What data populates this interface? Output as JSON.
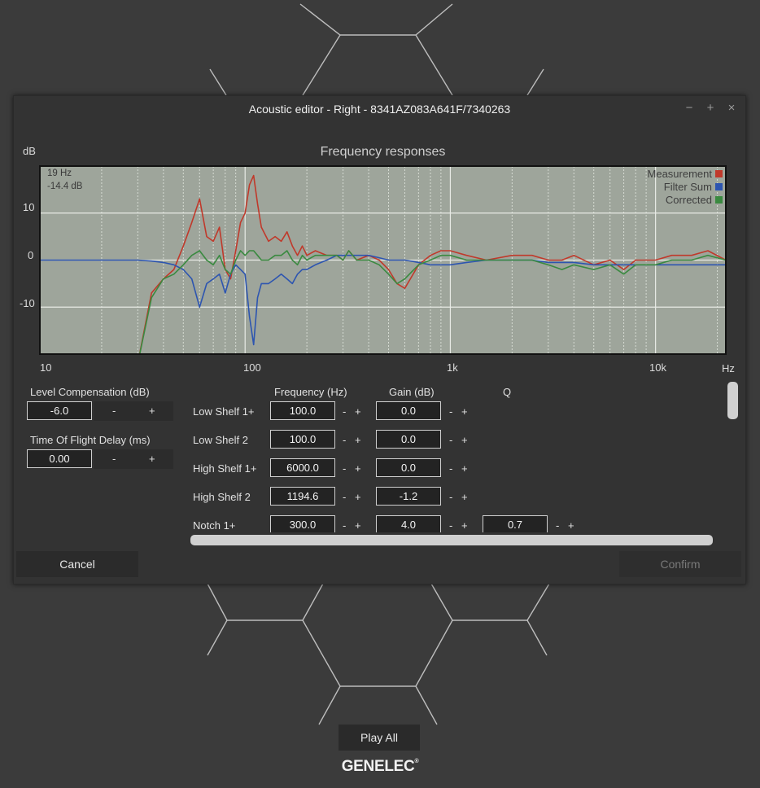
{
  "window": {
    "title": "Acoustic editor - Right - 8341AZ083A641F/7340263",
    "minimize_symbol": "−",
    "maximize_symbol": "+",
    "close_symbol": "×"
  },
  "chart_data": {
    "type": "line",
    "title": "Frequency responses",
    "ylabel": "dB",
    "xlabel": "Hz",
    "x_scale": "log",
    "xlim": [
      10,
      22000
    ],
    "ylim": [
      -20,
      20
    ],
    "x_ticks": [
      "10",
      "100",
      "1k",
      "10k"
    ],
    "y_ticks": [
      "10",
      "0",
      "-10"
    ],
    "grid": true,
    "legend_position": "top-right",
    "readout": {
      "frequency": "19 Hz",
      "level": "-14.4 dB"
    },
    "x": [
      10,
      30,
      35,
      40,
      45,
      50,
      55,
      60,
      65,
      70,
      75,
      80,
      85,
      90,
      95,
      100,
      105,
      110,
      115,
      120,
      130,
      140,
      150,
      160,
      170,
      180,
      190,
      200,
      220,
      250,
      280,
      300,
      320,
      350,
      400,
      450,
      500,
      550,
      600,
      700,
      800,
      900,
      1000,
      1200,
      1500,
      2000,
      2500,
      3000,
      3500,
      4000,
      5000,
      6000,
      7000,
      8000,
      10000,
      12000,
      15000,
      18000,
      22000
    ],
    "series": [
      {
        "name": "Measurement",
        "color": "#c0392b",
        "values": [
          -30,
          -30,
          -7,
          -4,
          -2,
          3,
          8,
          13,
          5,
          4,
          7,
          -2,
          -4,
          2,
          8,
          10,
          16,
          18,
          12,
          7,
          4,
          5,
          4,
          6,
          3,
          1,
          3,
          1,
          2,
          1,
          1,
          0,
          2,
          0,
          1,
          0,
          -2,
          -5,
          -6,
          -1,
          1,
          2,
          2,
          1,
          0,
          1,
          1,
          0,
          0,
          1,
          -1,
          0,
          -2,
          0,
          0,
          1,
          1,
          2,
          0
        ]
      },
      {
        "name": "Filter Sum",
        "color": "#2d55b0",
        "values": [
          0,
          0,
          -0.2,
          -0.5,
          -1,
          -2,
          -4,
          -10,
          -5,
          -4,
          -3,
          -7,
          -3,
          -1,
          -2,
          -3,
          -12,
          -18,
          -8,
          -5,
          -5,
          -4,
          -3,
          -4,
          -5,
          -3,
          -2,
          -2,
          -1,
          0,
          1,
          1,
          1,
          1,
          1,
          0.5,
          0,
          0,
          0,
          -0.5,
          -1,
          -1,
          -1,
          -0.5,
          0,
          0,
          0,
          -0.5,
          -0.5,
          -0.5,
          -1,
          -1,
          -1,
          -1,
          -1,
          -1,
          -1,
          -1,
          -1
        ]
      },
      {
        "name": "Corrected",
        "color": "#3a8a40",
        "values": [
          -30,
          -30,
          -8,
          -4,
          -3,
          -1,
          1,
          2,
          0,
          -1,
          1,
          -2,
          -3,
          0,
          2,
          1,
          2,
          2,
          1,
          0,
          0,
          1,
          1,
          2,
          0,
          -1,
          1,
          0,
          1,
          1,
          1,
          0,
          2,
          0,
          0,
          -1,
          -3,
          -5,
          -4,
          -1,
          0,
          1,
          1,
          0,
          0,
          0,
          0,
          -1,
          -2,
          -1,
          -2,
          -1,
          -3,
          -1,
          -1,
          0,
          0,
          1,
          0
        ]
      }
    ]
  },
  "controls": {
    "level_comp_label": "Level Compensation (dB)",
    "level_comp_value": "-6.0",
    "tof_label": "Time Of Flight Delay (ms)",
    "tof_value": "0.00",
    "minus": "-",
    "plus": "+",
    "col_frequency": "Frequency (Hz)",
    "col_gain": "Gain (dB)",
    "col_q": "Q"
  },
  "filters": [
    {
      "name": "Low Shelf 1+",
      "frequency": "100.0",
      "gain": "0.0",
      "q": ""
    },
    {
      "name": "Low Shelf 2",
      "frequency": "100.0",
      "gain": "0.0",
      "q": ""
    },
    {
      "name": "High Shelf 1+",
      "frequency": "6000.0",
      "gain": "0.0",
      "q": ""
    },
    {
      "name": "High Shelf 2",
      "frequency": "1194.6",
      "gain": "-1.2",
      "q": ""
    },
    {
      "name": "Notch 1+",
      "frequency": "300.0",
      "gain": "4.0",
      "q": "0.7"
    }
  ],
  "buttons": {
    "cancel": "Cancel",
    "confirm": "Confirm",
    "play_all": "Play All"
  },
  "brand": {
    "name": "GENELEC",
    "mark": "®"
  }
}
